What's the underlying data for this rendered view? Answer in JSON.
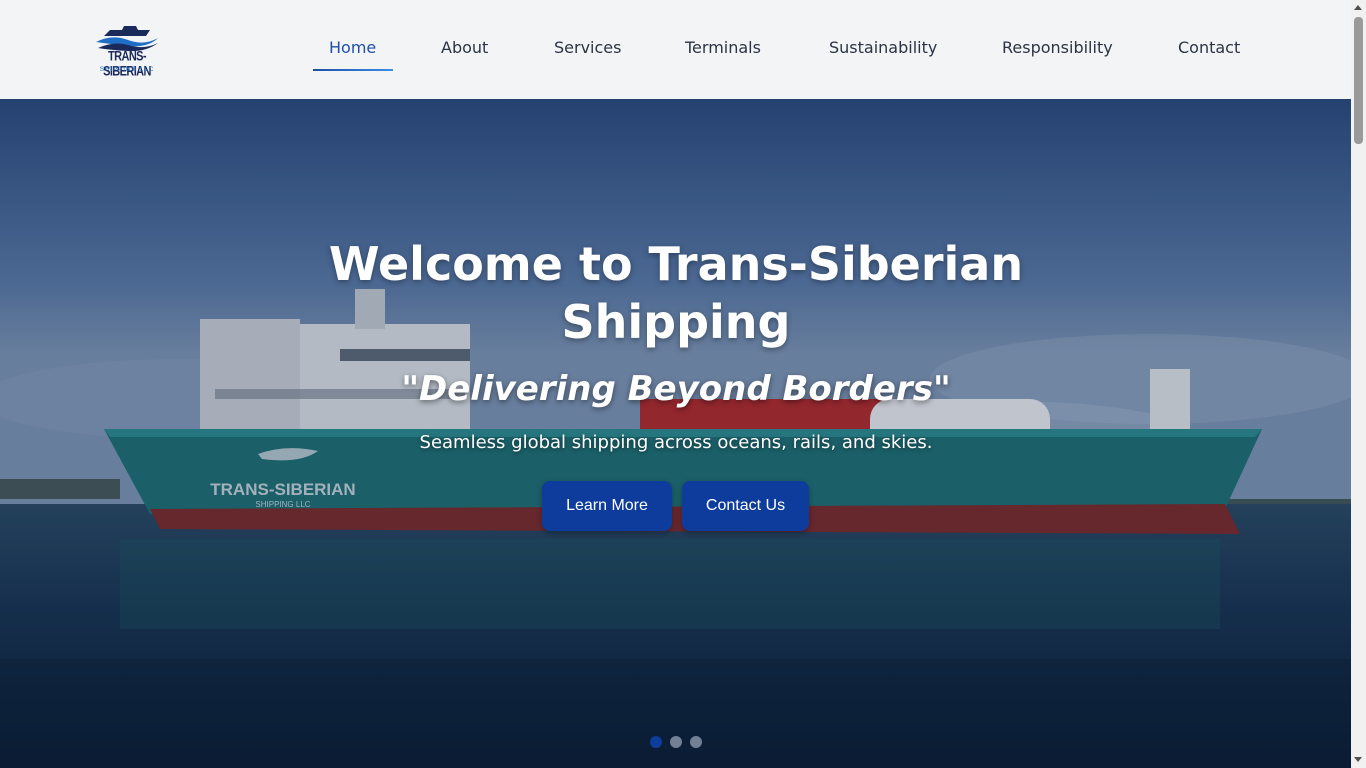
{
  "brand": {
    "name": "TRANS-SIBERIAN",
    "subtitle": "SHIPPING LLC"
  },
  "nav": {
    "items": [
      {
        "label": "Home",
        "active": true
      },
      {
        "label": "About"
      },
      {
        "label": "Services"
      },
      {
        "label": "Terminals"
      },
      {
        "label": "Sustainability"
      },
      {
        "label": "Responsibility"
      },
      {
        "label": "Contact"
      }
    ]
  },
  "hero": {
    "title": "Welcome to Trans-Siberian Shipping",
    "tagline": "\"Delivering Beyond Borders\"",
    "subtitle": "Seamless global shipping across oceans, rails, and skies.",
    "learn_more": "Learn More",
    "contact_us": "Contact Us",
    "slides": 3,
    "active_slide": 1,
    "ship_hull_text": "TRANS-SIBERIAN",
    "ship_hull_sub": "SHIPPING LLC"
  },
  "colors": {
    "accent": "#0d3c9c",
    "nav_active": "#1f4fa8",
    "header_bg": "#f3f4f6",
    "hull": "#1f6e72"
  }
}
